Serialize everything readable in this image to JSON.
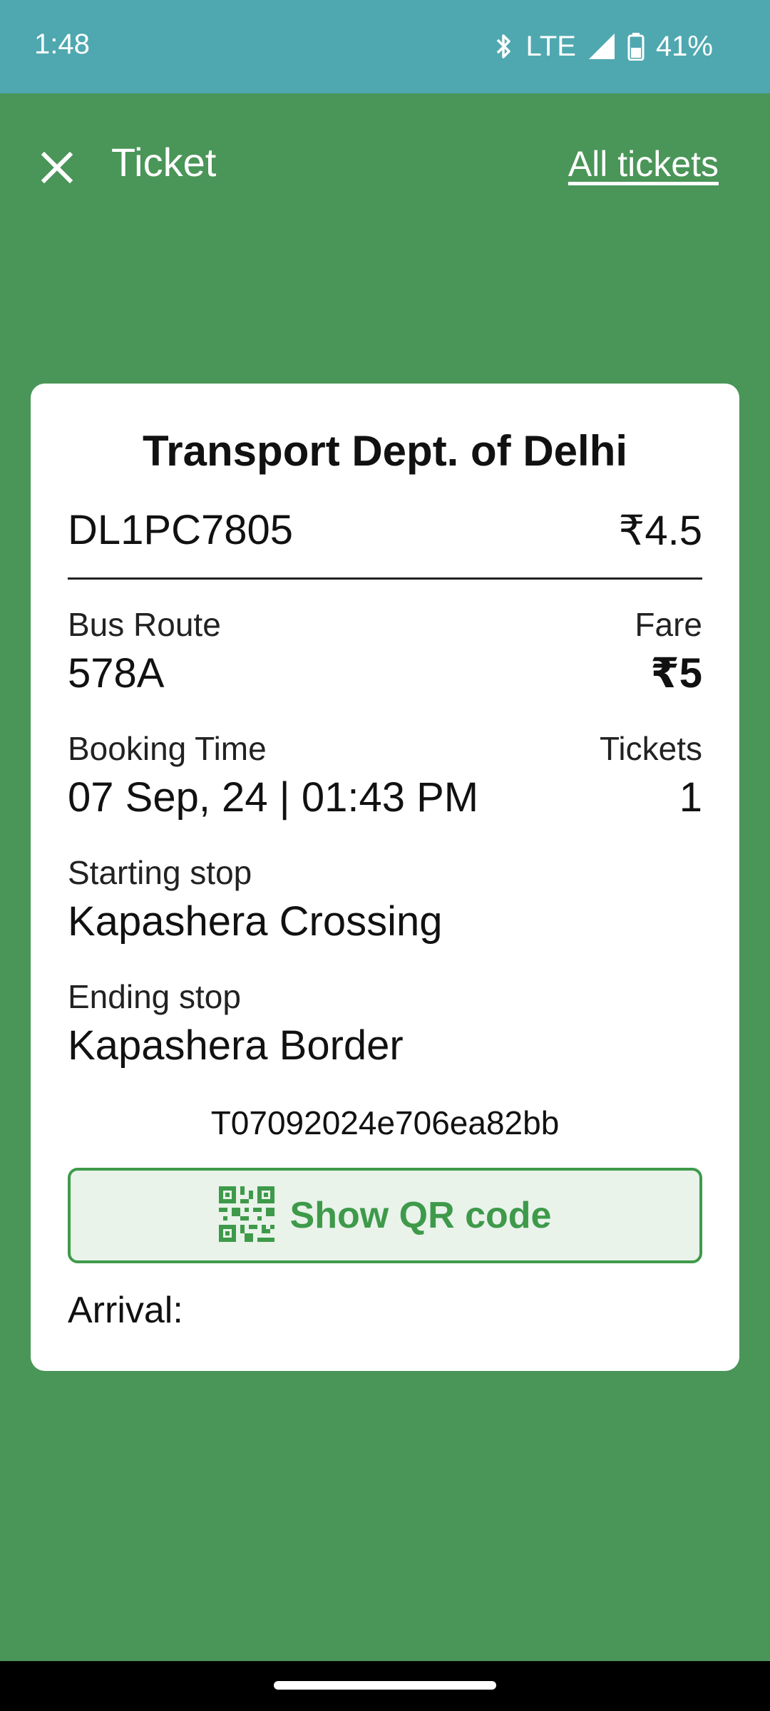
{
  "status_bar": {
    "time": "1:48",
    "network": "LTE",
    "battery": "41%"
  },
  "header": {
    "title": "Ticket",
    "all_tickets": "All tickets"
  },
  "ticket": {
    "agency": "Transport Dept. of Delhi",
    "vehicle_number": "DL1PC7805",
    "vehicle_fare": "₹4.5",
    "bus_route_label": "Bus Route",
    "bus_route": "578A",
    "fare_label": "Fare",
    "fare": "₹5",
    "booking_time_label": "Booking Time",
    "booking_time": "07 Sep, 24 | 01:43 PM",
    "tickets_label": "Tickets",
    "tickets": "1",
    "starting_stop_label": "Starting stop",
    "starting_stop": "Kapashera Crossing",
    "ending_stop_label": "Ending stop",
    "ending_stop": "Kapashera Border",
    "ticket_id": "T07092024e706ea82bb",
    "qr_button": "Show QR code",
    "arrival_label": "Arrival:"
  },
  "colors": {
    "background": "#4a9558",
    "status_bar": "#4fa8b0",
    "accent": "#3e9a4a",
    "button_bg": "#e9f3ea"
  },
  "icons": {
    "close": "close-icon",
    "bluetooth": "bluetooth-icon",
    "signal": "signal-icon",
    "battery": "battery-icon",
    "qr": "qr-code-icon"
  }
}
